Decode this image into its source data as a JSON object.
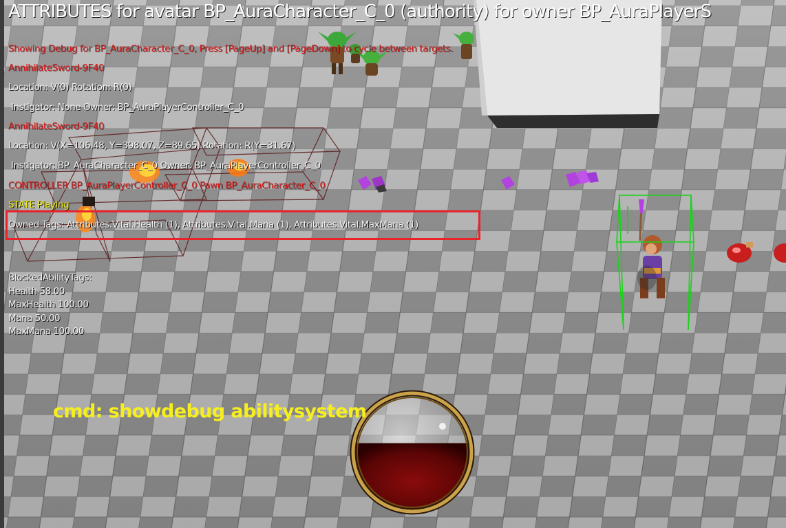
{
  "header": {
    "title": "ATTRIBUTES for avatar BP_AuraCharacter_C_0 (authority) for owner BP_AuraPlayerS"
  },
  "debug": {
    "showing": "Showing Debug for BP_AuraCharacter_C_0, Press [PageUp] and [PageDown] to cycle between targets.",
    "actor1_name": "AnnihilateSword-9F40",
    "actor1_location": "Location: V(0) Rotation: R(0)",
    "actor1_instigator": "Instigator: None Owner: BP_AuraPlayerController_C_0",
    "actor2_name": "AnnihilateSword-9F40",
    "actor2_location": "Location: V(X=106.48, Y=398.07, Z=89.65) Rotation: R(Y=31.67)",
    "actor2_instigator": "Instigator: BP_AuraCharacter_C_0 Owner: BP_AuraPlayerController_C_0",
    "controller": "CONTROLLER BP_AuraPlayerController_C_0 Pawn BP_AuraCharacter_C_0",
    "state": "STATE Playing",
    "owned_tags": "Owned Tags: Attributes.Vital.Health (1), Attributes.Vital.Mana (1), Attributes.Vital.MaxMana (1)",
    "blocked_tags": "BlockedAbilityTags:"
  },
  "attributes": [
    {
      "label": "Health 58.00"
    },
    {
      "label": "MaxHealth 100.00"
    },
    {
      "label": "Mana 50.00"
    },
    {
      "label": "MaxMana 100.00"
    }
  ],
  "caption": "cmd: showdebug abilitysystem",
  "hud": {
    "health_fraction": 0.58,
    "orb_fill_color": "#8a0b0b",
    "orb_rim_color": "#c9a24a"
  },
  "colors": {
    "debug_red": "#d41a1a",
    "debug_white": "#f2f2f2",
    "debug_yellow": "#eded1a",
    "highlight": "#e8232a",
    "caption": "#f7ef1d",
    "collision_box": "#19d219",
    "crystal": "#b243e0"
  },
  "icons": {
    "character": "aura-character",
    "enemies": "goblin-icon",
    "pickups": "crystal-icon",
    "potions": "health-potion-icon"
  }
}
